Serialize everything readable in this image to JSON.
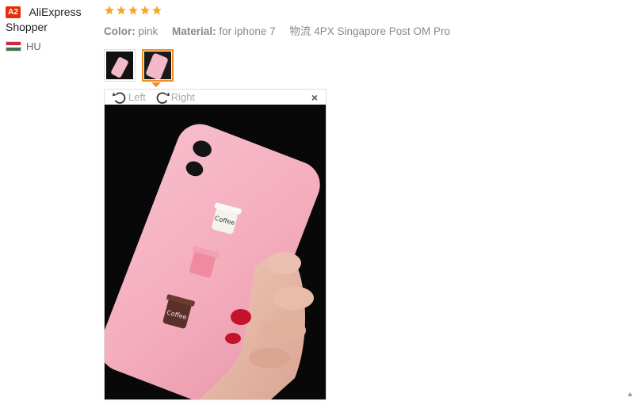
{
  "user": {
    "badge": "A2",
    "name_first": "AliExpress",
    "name_second": "Shopper",
    "country_code": "HU"
  },
  "review": {
    "rating": 5,
    "star_color": "#f5a623",
    "attributes": [
      {
        "label": "Color:",
        "value": "pink"
      },
      {
        "label": "Material:",
        "value": "for iphone 7"
      },
      {
        "label": "物流",
        "value": "4PX Singapore Post OM Pro"
      }
    ]
  },
  "viewer": {
    "rotate_left_label": "Left",
    "rotate_right_label": "Right",
    "close_label": "×",
    "cup_text": "Coffee"
  },
  "colors": {
    "accent": "#f08a24",
    "badge_red": "#e62e04"
  }
}
